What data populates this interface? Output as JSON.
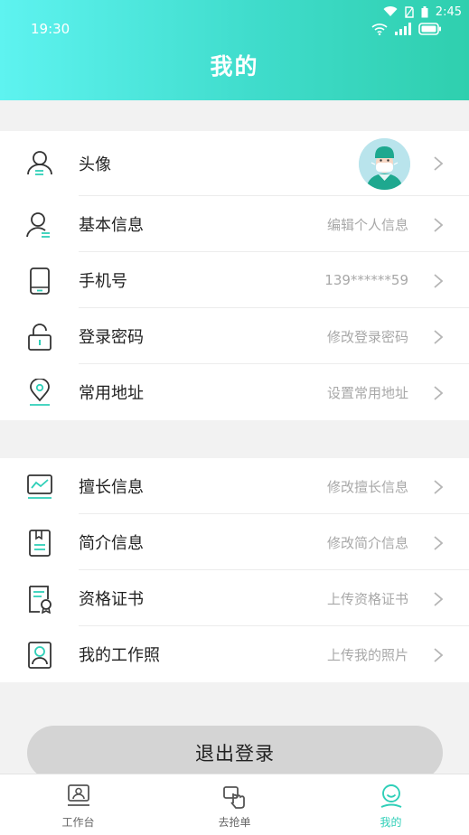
{
  "status": {
    "time_app": "19:30",
    "time_system": "2:45"
  },
  "header": {
    "title": "我的"
  },
  "profile": {
    "items": [
      {
        "label": "头像",
        "hint": ""
      },
      {
        "label": "基本信息",
        "hint": "编辑个人信息"
      },
      {
        "label": "手机号",
        "hint": "139******59"
      },
      {
        "label": "登录密码",
        "hint": "修改登录密码"
      },
      {
        "label": "常用地址",
        "hint": "设置常用地址"
      }
    ]
  },
  "professional": {
    "items": [
      {
        "label": "擅长信息",
        "hint": "修改擅长信息"
      },
      {
        "label": "简介信息",
        "hint": "修改简介信息"
      },
      {
        "label": "资格证书",
        "hint": "上传资格证书"
      },
      {
        "label": "我的工作照",
        "hint": "上传我的照片"
      }
    ]
  },
  "logout": {
    "label": "退出登录"
  },
  "tabs": [
    {
      "label": "工作台",
      "icon": "workbench-icon"
    },
    {
      "label": "去抢单",
      "icon": "grab-order-icon"
    },
    {
      "label": "我的",
      "icon": "me-icon"
    }
  ],
  "colors": {
    "accent": "#2fcfb8",
    "header_start": "#5ef3f0",
    "header_end": "#2fcfae",
    "hint": "#a8a8a8"
  }
}
